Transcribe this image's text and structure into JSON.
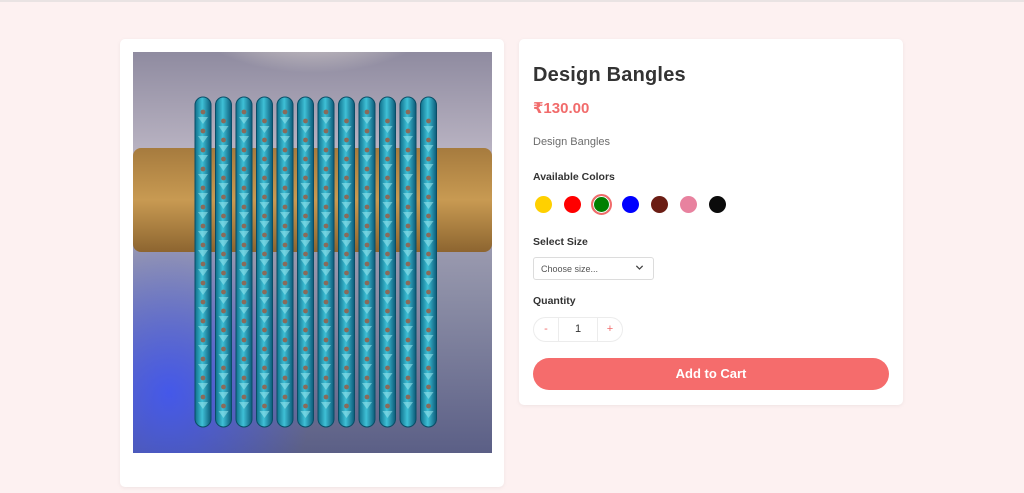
{
  "product": {
    "title": "Design Bangles",
    "price": "₹130.00",
    "description": "Design Bangles",
    "image_alt": "Teal crystal bangles on wooden holder"
  },
  "colors": {
    "label": "Available Colors",
    "options": [
      {
        "name": "yellow",
        "hex": "#ffd000"
      },
      {
        "name": "red",
        "hex": "#ff0000"
      },
      {
        "name": "green",
        "hex": "#008000"
      },
      {
        "name": "blue",
        "hex": "#0000ff"
      },
      {
        "name": "brown",
        "hex": "#6b1d14"
      },
      {
        "name": "pink",
        "hex": "#e8829f"
      },
      {
        "name": "black",
        "hex": "#0b0b0b"
      }
    ],
    "selected": "green"
  },
  "size": {
    "label": "Select Size",
    "placeholder": "Choose size..."
  },
  "quantity": {
    "label": "Quantity",
    "value": "1",
    "decrement": "-",
    "increment": "+"
  },
  "cart": {
    "button_label": "Add to Cart"
  },
  "theme": {
    "accent": "#f56c6c",
    "background": "#fdf1f1"
  }
}
